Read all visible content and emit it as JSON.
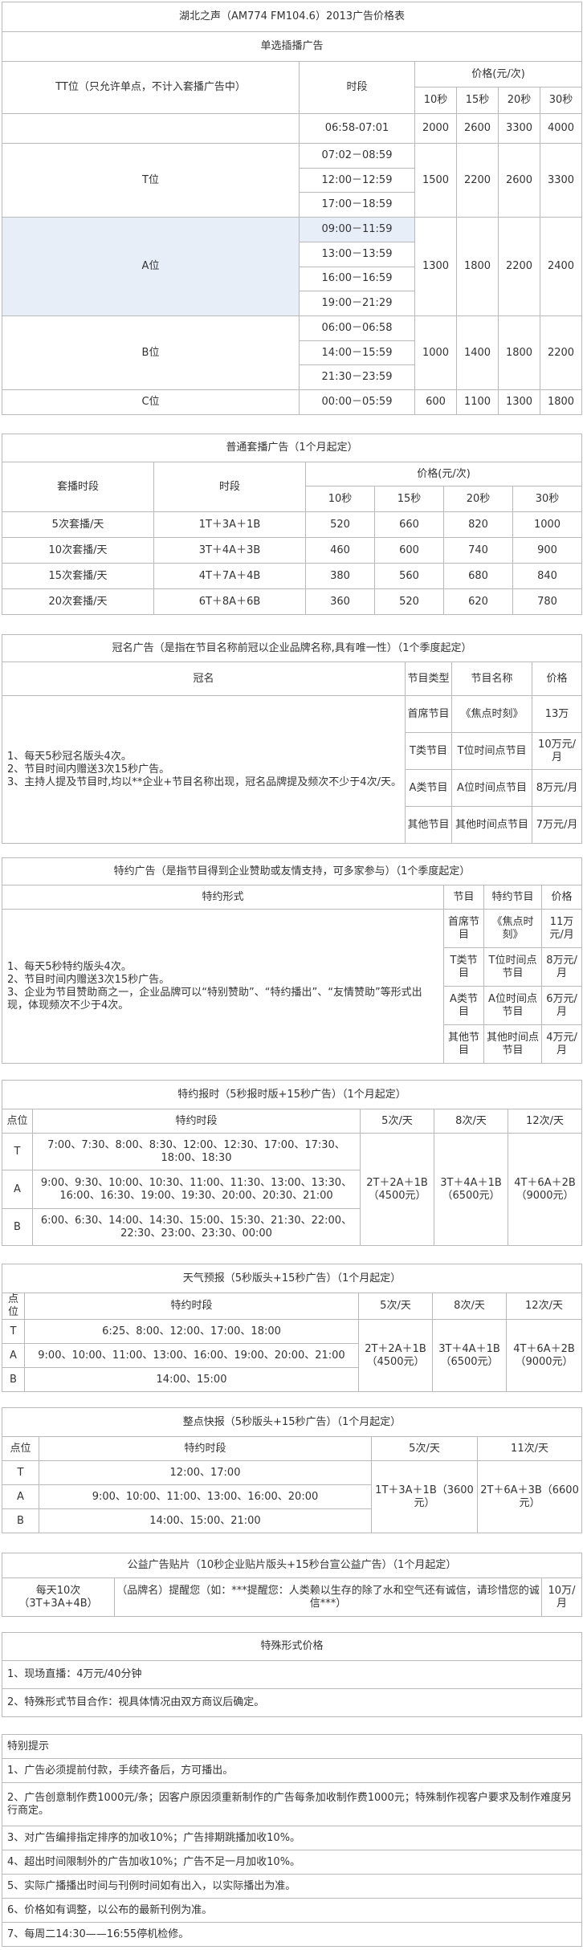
{
  "main": {
    "title": "湖北之声（AM774 FM104.6）2013广告价格表",
    "subtitle": "单选插播广告",
    "col_point": "TT位（只允许单点，不计入套播广告中）",
    "col_slot": "时段",
    "col_price": "价格(元/次)",
    "secs": [
      "10秒",
      "15秒",
      "20秒",
      "30秒"
    ],
    "rows": [
      {
        "label": "",
        "slots": [
          "06:58-07:01"
        ],
        "prices": [
          "2000",
          "2600",
          "3300",
          "4000"
        ]
      },
      {
        "label": "T位",
        "slots": [
          "07:02－08:59",
          "12:00－12:59",
          "17:00－18:59"
        ],
        "prices": [
          "1500",
          "2200",
          "2600",
          "3300"
        ]
      },
      {
        "label": "A位",
        "slots": [
          "09:00－11:59",
          "13:00－13:59",
          "16:00－16:59",
          "19:00－21:29"
        ],
        "prices": [
          "1300",
          "1800",
          "2200",
          "2400"
        ]
      },
      {
        "label": "B位",
        "slots": [
          "06:00－06:58",
          "14:00－15:59",
          "21:30－23:59"
        ],
        "prices": [
          "1000",
          "1400",
          "1800",
          "2200"
        ]
      },
      {
        "label": "C位",
        "slots": [
          "00:00－05:59"
        ],
        "prices": [
          "600",
          "1100",
          "1300",
          "1800"
        ]
      }
    ]
  },
  "bundle": {
    "title": "普通套播广告（1个月起定）",
    "col_freq": "套播时段",
    "col_slot": "时段",
    "col_price": "价格(元/次)",
    "secs": [
      "10秒",
      "15秒",
      "20秒",
      "30秒"
    ],
    "rows": [
      {
        "freq": "5次套播/天",
        "slot": "1T＋3A＋1B",
        "prices": [
          "520",
          "660",
          "820",
          "1000"
        ]
      },
      {
        "freq": "10次套播/天",
        "slot": "3T＋4A＋3B",
        "prices": [
          "460",
          "600",
          "740",
          "900"
        ]
      },
      {
        "freq": "15次套播/天",
        "slot": "4T＋7A＋4B",
        "prices": [
          "380",
          "560",
          "680",
          "840"
        ]
      },
      {
        "freq": "20次套播/天",
        "slot": "6T＋8A＋6B",
        "prices": [
          "360",
          "520",
          "620",
          "780"
        ]
      }
    ]
  },
  "naming": {
    "title": "冠名广告（是指在节目名称前冠以企业品牌名称,具有唯一性）（1个季度起定）",
    "col_form": "冠名",
    "col_type": "节目类型",
    "col_name": "节目名称",
    "col_price": "价格",
    "desc": [
      "1、每天5秒冠名版头4次。",
      "2、节目时间内赠送3次15秒广告。",
      "3、主持人提及节目时,均以**企业+节目名称出现，冠名品牌提及频次不少于4次/天。"
    ],
    "rows": [
      {
        "type": "首席节目",
        "name": "《焦点时刻》",
        "price": "13万"
      },
      {
        "type": "T类节目",
        "name": "T位时间点节目",
        "price": "10万元/月"
      },
      {
        "type": "A类节目",
        "name": "A位时间点节目",
        "price": "8万元/月"
      },
      {
        "type": "其他节目",
        "name": "其他时间点节目",
        "price": "7万元/月"
      }
    ]
  },
  "sponsor": {
    "title": "特约广告（是指节目得到企业赞助或友情支持，可多家参与）（1个季度起定）",
    "col_form": "特约形式",
    "col_type": "节目",
    "col_name": "特约节目",
    "col_price": "价格",
    "desc": [
      "1、每天5秒特约版头4次。",
      "2、节目时间内赠送3次15秒广告。",
      "3、企业为节目赞助商之一，企业品牌可以“特别赞助”、“特约播出”、“友情赞助”等形式出现，体现频次不少于4次。"
    ],
    "rows": [
      {
        "type": "首席节目",
        "name": "《焦点时刻》",
        "price": "11万元/月"
      },
      {
        "type": "T类节目",
        "name": "T位时间点节目",
        "price": "8万元/月"
      },
      {
        "type": "A类节目",
        "name": "A位时间点节目",
        "price": "6万元/月"
      },
      {
        "type": "其他节目",
        "name": "其他时间点节目",
        "price": "4万元/月"
      }
    ]
  },
  "timecheck": {
    "title": "特约报时（5秒报时版+15秒广告）（1个月起定）",
    "col_point": "点位",
    "col_slot": "特约时段",
    "freqs": [
      "5次/天",
      "8次/天",
      "12次/天"
    ],
    "combos": [
      "2T＋2A＋1B（4500元）",
      "3T＋4A＋1B（6500元）",
      "4T＋6A＋2B（9000元）"
    ],
    "rows": [
      {
        "point": "T",
        "slot": "7:00、7:30、8:00、8:30、12:00、12:30、17:00、17:30、18:00、18:30"
      },
      {
        "point": "A",
        "slot": "9:00、9:30、10:00、10:30、11:00、11:30、13:00、13:30、16:00、16:30、19:00、19:30、20:00、20:30、21:00"
      },
      {
        "point": "B",
        "slot": "6:00、6:30、14:00、14:30、15:00、15:30、21:30、22:00、22:30、23:00、23:30、00:00"
      }
    ]
  },
  "weather": {
    "title": "天气预报（5秒版头+15秒广告）（1个月起定）",
    "col_point": "点位",
    "col_slot": "特约时段",
    "freqs": [
      "5次/天",
      "8次/天",
      "12次/天"
    ],
    "combos": [
      "2T＋2A＋1B（4500元）",
      "3T＋4A＋1B（6500元）",
      "4T＋6A＋2B（9000元）"
    ],
    "rows": [
      {
        "point": "T",
        "slot": "6:25、8:00、12:00、17:00、18:00"
      },
      {
        "point": "A",
        "slot": "9:00、10:00、11:00、13:00、16:00、19:00、20:00、21:00"
      },
      {
        "point": "B",
        "slot": "14:00、15:00"
      }
    ]
  },
  "news": {
    "title": "整点快报（5秒版头+15秒广告）（1个月起定）",
    "col_point": "点位",
    "col_slot": "特约时段",
    "freqs": [
      "5次/天",
      "11次/天"
    ],
    "combos": [
      "1T＋3A＋1B（3600元）",
      "2T＋6A＋3B（6600元）"
    ],
    "rows": [
      {
        "point": "T",
        "slot": "12:00、17:00"
      },
      {
        "point": "A",
        "slot": "9:00、10:00、11:00、13:00、16:00、20:00"
      },
      {
        "point": "B",
        "slot": "14:00、15:00、21:00"
      }
    ]
  },
  "psa": {
    "title": "公益广告贴片（10秒企业贴片版头+15秒台宣公益广告）（1个月起定）",
    "freq": "每天10次（3T+3A+4B）",
    "content": "（品牌名）提醒您（如：***提醒您：人类赖以生存的除了水和空气还有诚信，请珍惜您的诚信***）",
    "price": "10万/月"
  },
  "special": {
    "title": "特殊形式价格",
    "items": [
      "1、现场直播：4万元/40分钟",
      "2、特殊形式节目合作：视具体情况由双方商议后确定。"
    ]
  },
  "tips": {
    "title": "特别提示",
    "items": [
      "1、广告必须提前付款，手续齐备后，方可播出。",
      "2、广告创意制作费1000元/条；因客户原因须重新制作的广告每条加收制作费1000元；特殊制作视客户要求及制作难度另行商定。",
      "3、对广告编排指定排序的加收10%；广告排期跳播加收10%。",
      "4、超出时间限制外的广告加收10%；广告不足一月加收10%。",
      "5、实际广播播出时间与刊例时间如有出入，以实际播出为准。",
      "6、价格如有调整，以公布的最新刊例为准。",
      "7、每周二14:30——16:55停机检修。"
    ]
  }
}
